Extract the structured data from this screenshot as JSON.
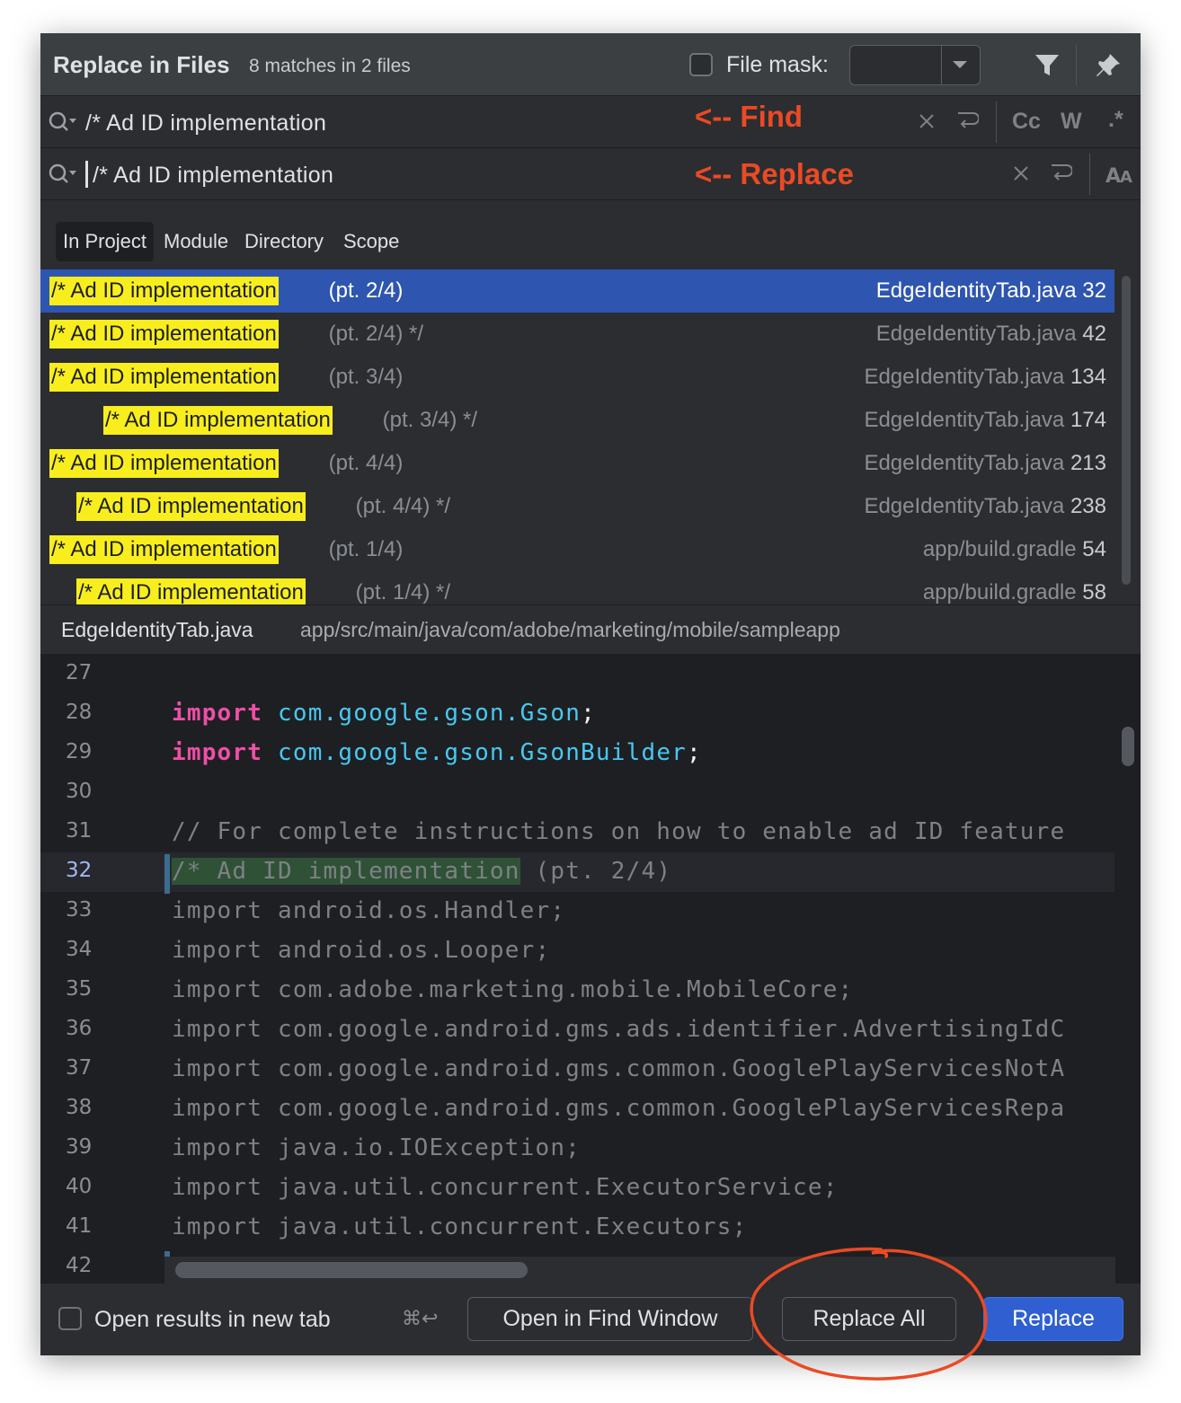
{
  "header": {
    "title": "Replace in Files",
    "subtitle": "8 matches in 2 files",
    "file_mask_label": "File mask:"
  },
  "find": {
    "query": "/* Ad ID implementation",
    "annotation": "<-- Find",
    "toggles": {
      "case": "Cc",
      "words": "W",
      "regex": ".*"
    }
  },
  "replace": {
    "value": "/* Ad ID implementation",
    "annotation": "<-- Replace"
  },
  "scope_tabs": [
    {
      "label": "In Project",
      "active": true
    },
    {
      "label": "Module"
    },
    {
      "label": "Directory"
    },
    {
      "label": "Scope"
    }
  ],
  "results": [
    {
      "match": "/* Ad ID implementation",
      "rest": " (pt. 2/4)",
      "file": "EdgeIdentityTab.java",
      "line": "32",
      "selected": true
    },
    {
      "match": "/* Ad ID implementation",
      "rest": " (pt. 2/4) */",
      "file": "EdgeIdentityTab.java",
      "line": "42"
    },
    {
      "match": "/* Ad ID implementation",
      "rest": " (pt. 3/4)",
      "file": "EdgeIdentityTab.java",
      "line": "134"
    },
    {
      "match": "/* Ad ID implementation",
      "rest": " (pt. 3/4) */",
      "file": "EdgeIdentityTab.java",
      "line": "174"
    },
    {
      "match": "/* Ad ID implementation",
      "rest": " (pt. 4/4)",
      "file": "EdgeIdentityTab.java",
      "line": "213"
    },
    {
      "match": "/* Ad ID implementation",
      "rest": " (pt. 4/4) */",
      "file": "EdgeIdentityTab.java",
      "line": "238"
    },
    {
      "match": "/* Ad ID implementation",
      "rest": " (pt. 1/4)",
      "file": "app/build.gradle",
      "line": "54"
    },
    {
      "match": "/* Ad ID implementation",
      "rest": " (pt. 1/4) */",
      "file": "app/build.gradle",
      "line": "58"
    }
  ],
  "preview": {
    "file": "EdgeIdentityTab.java",
    "path": "app/src/main/java/com/adobe/marketing/mobile/sampleapp",
    "lines": [
      {
        "num": "27",
        "text": ""
      },
      {
        "num": "28",
        "kw": "import",
        "pkg": "com.google.gson.Gson",
        "end": ";"
      },
      {
        "num": "29",
        "kw": "import",
        "pkg": "com.google.gson.GsonBuilder",
        "end": ";"
      },
      {
        "num": "30",
        "text": ""
      },
      {
        "num": "31",
        "comment": "// For complete instructions on how to enable ad ID feature"
      },
      {
        "num": "32",
        "hit": "/* Ad ID implementation",
        "rest": " (pt. 2/4)",
        "current": true
      },
      {
        "num": "33",
        "text": "import android.os.Handler;"
      },
      {
        "num": "34",
        "text": "import android.os.Looper;"
      },
      {
        "num": "35",
        "text": "import com.adobe.marketing.mobile.MobileCore;"
      },
      {
        "num": "36",
        "text": "import com.google.android.gms.ads.identifier.AdvertisingIdC"
      },
      {
        "num": "37",
        "text": "import com.google.android.gms.common.GooglePlayServicesNotA"
      },
      {
        "num": "38",
        "text": "import com.google.android.gms.common.GooglePlayServicesRepa"
      },
      {
        "num": "39",
        "text": "import java.io.IOException;"
      },
      {
        "num": "40",
        "text": "import java.util.concurrent.ExecutorService;"
      },
      {
        "num": "41",
        "text": "import java.util.concurrent.Executors;"
      },
      {
        "num": "42",
        "text": ""
      }
    ]
  },
  "footer": {
    "open_new_tab_label": "Open results in new tab",
    "shortcut": "⌘↩",
    "open_find_window": "Open in Find Window",
    "replace_all": "Replace All",
    "replace": "Replace"
  },
  "colors": {
    "dialog_bg": "#2b2d30",
    "editor_bg": "#1e1f22",
    "selection": "#2e55b0",
    "match_highlight": "#f8ee1e",
    "annotation": "#ea4a25",
    "keyword": "#ee4fa6",
    "package": "#47c8f1",
    "primary_button": "#2f5fd1"
  }
}
